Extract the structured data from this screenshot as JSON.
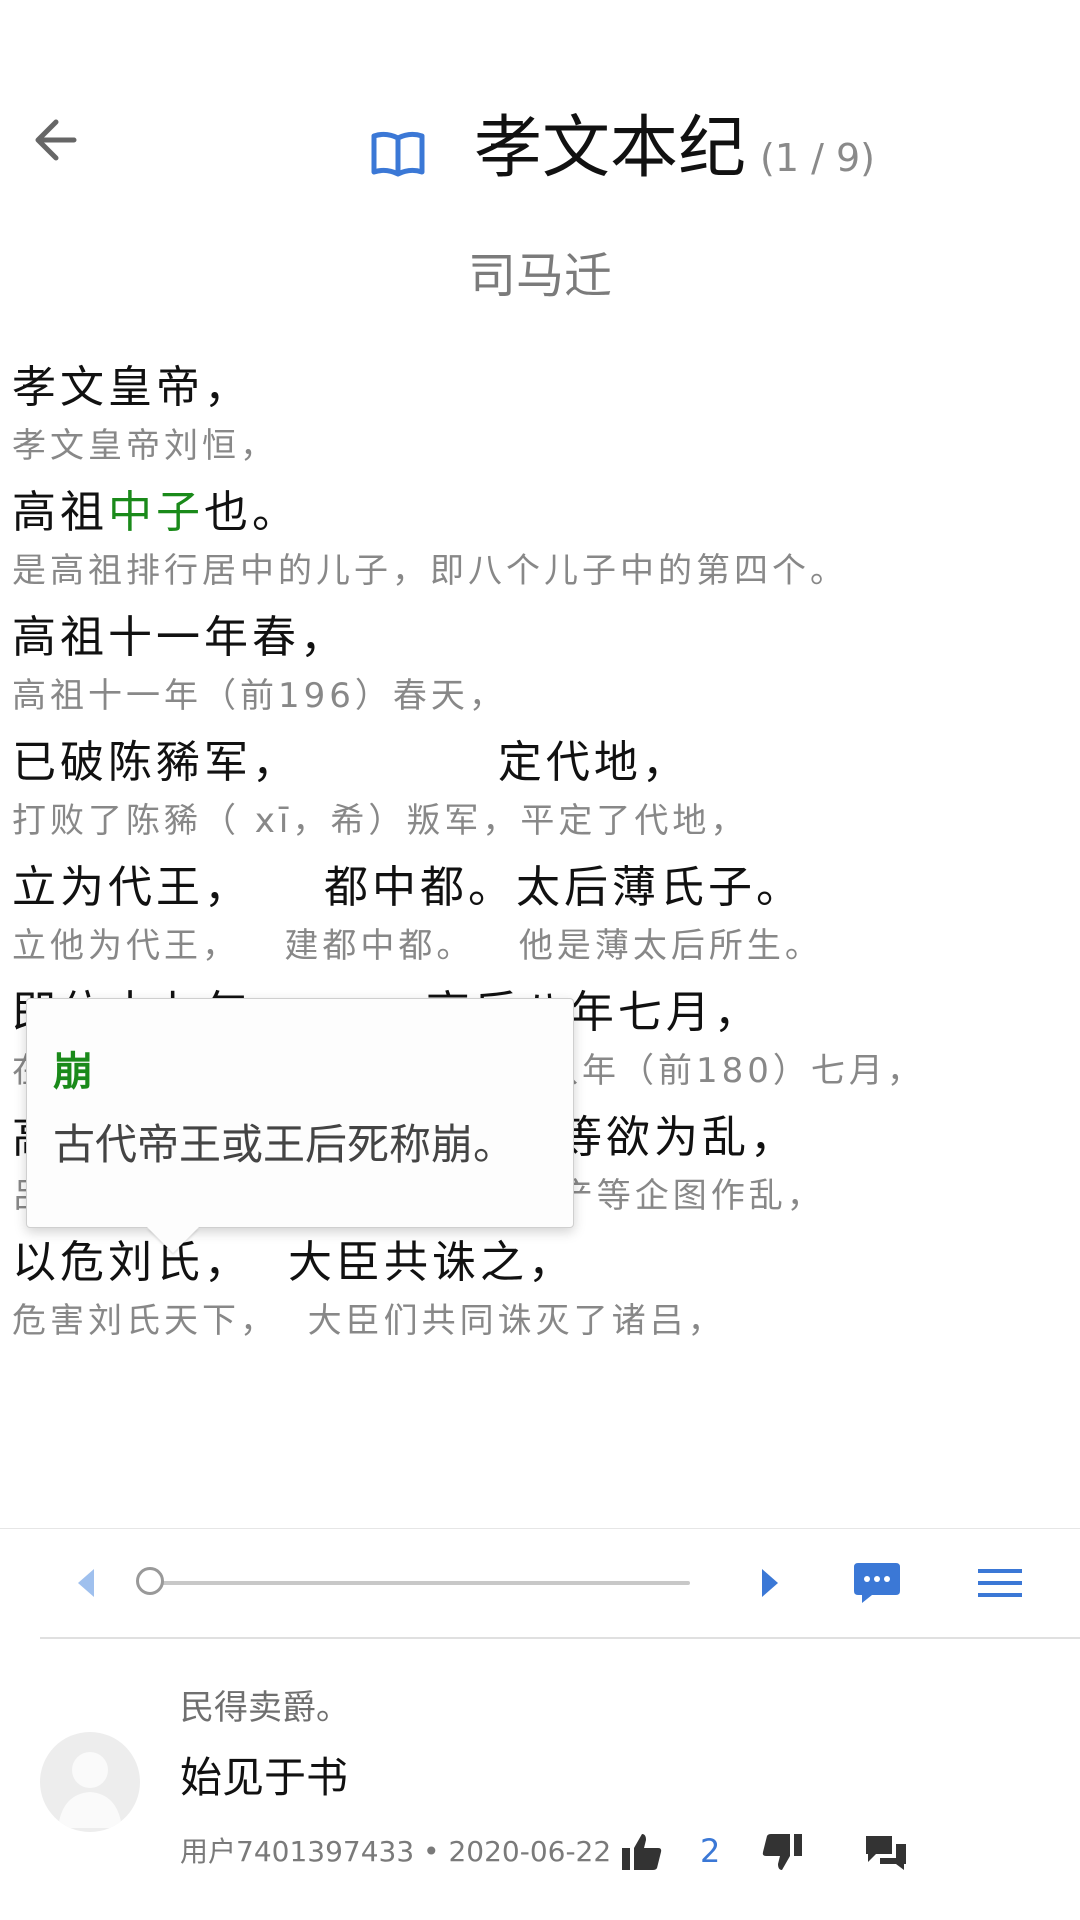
{
  "header": {
    "back_icon": "arrow-left-icon",
    "book_icon": "open-book-icon",
    "title": "孝文本纪",
    "count": "(1 / 9)",
    "author": "司马迁"
  },
  "colors": {
    "highlight": "#1a8a1a",
    "accent": "#3b78d6"
  },
  "lines": [
    {
      "orig_a": "孝文皇帝，",
      "orig_hl": "",
      "orig_b": "",
      "trans": "孝文皇帝刘恒，"
    },
    {
      "orig_a": "高祖",
      "orig_hl": "中子",
      "orig_b": "也。",
      "trans": "是高祖排行居中的儿子，即八个儿子中的第四个。"
    },
    {
      "orig_a": "高祖十一年春，",
      "orig_hl": "",
      "orig_b": "",
      "trans": "高祖十一年（前196）春天，"
    },
    {
      "orig_a": "已破陈豨军，           定代地，",
      "orig_hl": "",
      "orig_b": "",
      "trans": "打败了陈豨（ xī，希）叛军，平定了代地，"
    },
    {
      "orig_a": "立为代王，    都中都。",
      "orig_hl": "",
      "orig_b": "太后薄氏子。",
      "trans": "立他为代王，   建都中都。   他是薄太后所生。"
    },
    {
      "orig_a": "即位十七年，       高后八年七月，",
      "orig_hl": "",
      "orig_b": "",
      "trans": "在他做代王的第十七年，即吕后八年（前180）七月，"
    },
    {
      "orig_a": "高后",
      "orig_hl": "崩",
      "orig_b": "。 九月，诸吕吕产等欲为乱，",
      "trans": "吕后去世。九月， 吕氏家族的吕产等企图作乱，"
    },
    {
      "orig_a": "以危刘氏，  大臣共诛之，",
      "orig_hl": "",
      "orig_b": "",
      "trans": "危害刘氏天下，  大臣们共同诛灭了诸吕，"
    }
  ],
  "tooltip": {
    "term": "崩",
    "definition": "古代帝王或王后死称崩。"
  },
  "toolbar": {
    "prev_icon": "triangle-left-icon",
    "progress": 0.0,
    "next_icon": "triangle-right-icon",
    "comment_icon": "comment-bubble-icon",
    "menu_icon": "menu-icon"
  },
  "comment": {
    "quote": "民得卖爵。",
    "text": "始见于书",
    "meta": "用户7401397433 • 2020-06-22",
    "like_count": "2",
    "avatar_icon": "default-avatar-icon",
    "like_icon": "thumbs-up-icon",
    "dislike_icon": "thumbs-down-icon",
    "reply_icon": "reply-bubbles-icon"
  }
}
